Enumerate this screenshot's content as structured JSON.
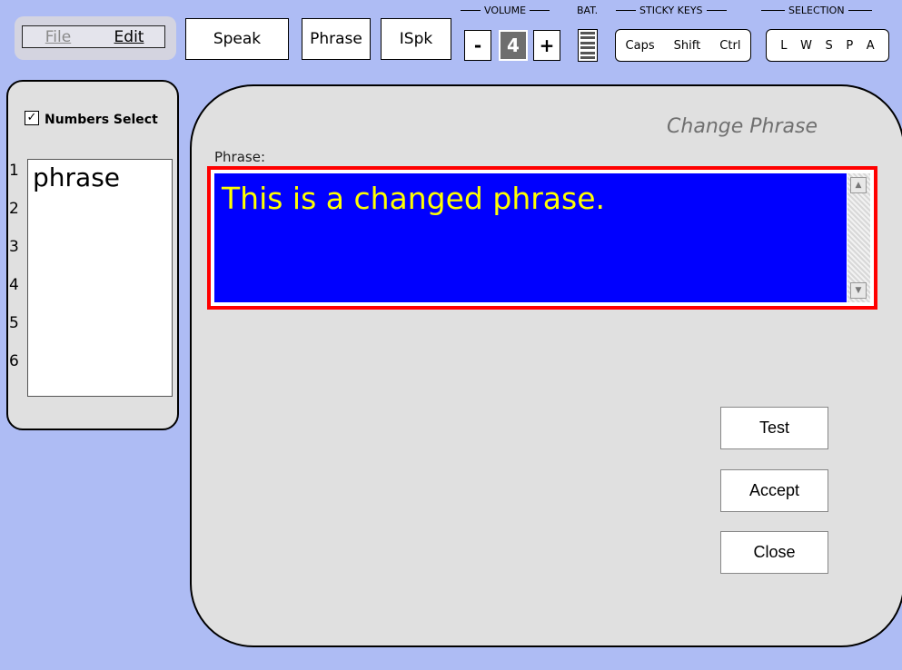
{
  "menu": {
    "file_label": "File",
    "edit_label": "Edit"
  },
  "toolbar": {
    "speak_label": "Speak",
    "phrase_label": "Phrase",
    "ispk_label": "ISpk"
  },
  "volume": {
    "label": "VOLUME",
    "minus": "-",
    "value": "4",
    "plus": "+"
  },
  "battery": {
    "label": "BAT."
  },
  "sticky_keys": {
    "label": "STICKY KEYS",
    "keys": [
      "Caps",
      "Shift",
      "Ctrl"
    ]
  },
  "selection": {
    "label": "SELECTION",
    "modes": [
      "L",
      "W",
      "S",
      "P",
      "A"
    ]
  },
  "left_panel": {
    "checkbox_mark": "✓",
    "numbers_select_label": "Numbers Select",
    "numbers": [
      "1",
      "2",
      "3",
      "4",
      "5",
      "6"
    ],
    "phrases": [
      "phrase"
    ]
  },
  "dialog": {
    "title": "Change Phrase",
    "phrase_label": "Phrase:",
    "phrase_value": "This is a changed phrase.",
    "buttons": {
      "test": "Test",
      "accept": "Accept",
      "close": "Close"
    }
  },
  "colors": {
    "background": "#aebcf4",
    "phrase_bg": "#0000ff",
    "phrase_text": "#ffff00",
    "highlight_border": "#ff0000"
  },
  "icons": {
    "scroll_up": "scroll-up-arrow-icon",
    "scroll_down": "scroll-down-arrow-icon",
    "battery": "battery-icon"
  }
}
